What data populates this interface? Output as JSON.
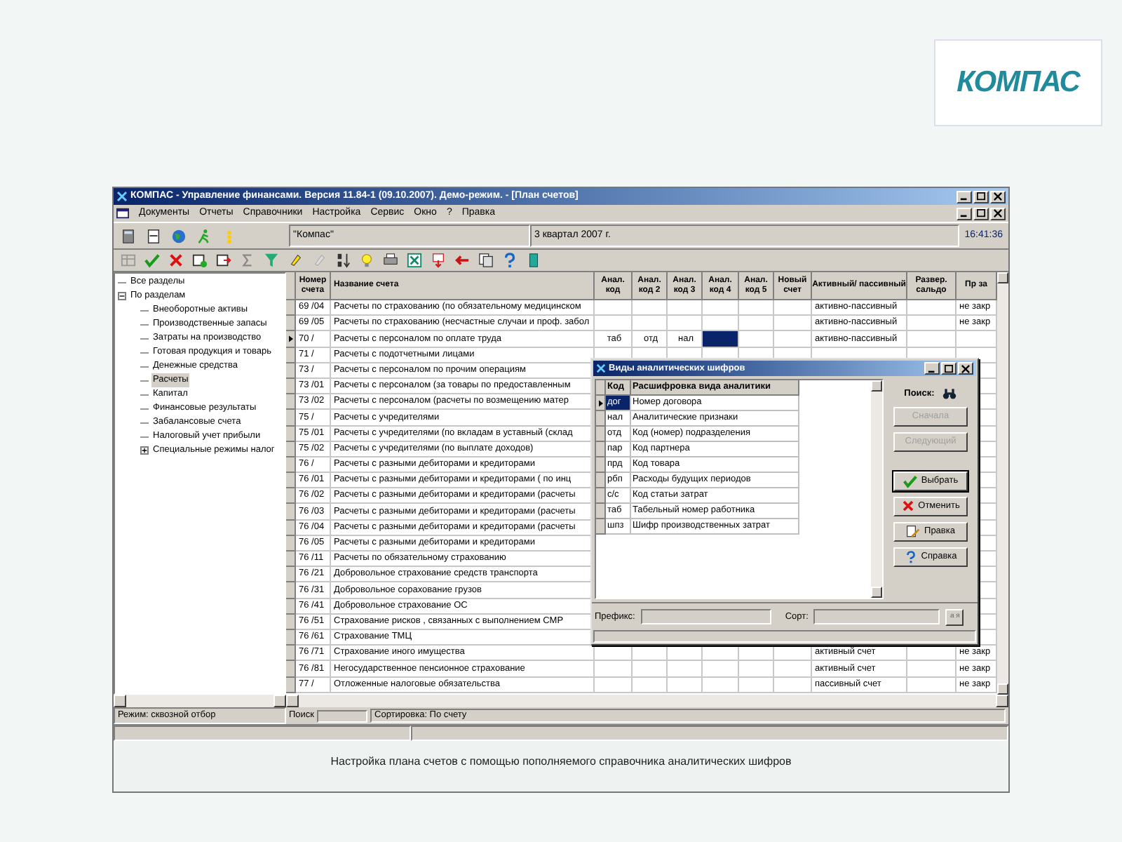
{
  "logo": {
    "text": "КОМПАС"
  },
  "window": {
    "title": "КОМПАС - Управление финансами. Версия 11.84-1 (09.10.2007). Демо-режим. - [План счетов]"
  },
  "menu": [
    "Документы",
    "Отчеты",
    "Справочники",
    "Настройка",
    "Сервис",
    "Окно",
    "?",
    "Правка"
  ],
  "toolbar": {
    "company": "\"Компас\"",
    "period": "3 квартал 2007 г.",
    "time": "16:41:36"
  },
  "tree": {
    "items": [
      {
        "label": "Все разделы",
        "selected": false
      },
      {
        "label": "По разделам",
        "selected": false,
        "expanded": true,
        "children": [
          {
            "label": "Внеоборотные активы",
            "selected": false
          },
          {
            "label": "Производственные запасы",
            "selected": false
          },
          {
            "label": "Затраты на производство",
            "selected": false
          },
          {
            "label": "Готовая продукция и товарь",
            "selected": false
          },
          {
            "label": "Денежные средства",
            "selected": false
          },
          {
            "label": "Расчеты",
            "selected": true
          },
          {
            "label": "Капитал",
            "selected": false
          },
          {
            "label": "Финансовые результаты",
            "selected": false
          },
          {
            "label": "Забалансовые счета",
            "selected": false
          },
          {
            "label": "Налоговый учет прибыли",
            "selected": false
          },
          {
            "label": "Специальные режимы налог",
            "selected": false,
            "expanded": false
          }
        ]
      }
    ],
    "mode": "Режим: сквозной отбор"
  },
  "table": {
    "columns": [
      "Номер счета",
      "Название счета",
      "Анал. код",
      "Анал. код 2",
      "Анал. код 3",
      "Анал. код 4",
      "Анал. код 5",
      "Новый счет",
      "Активный/ пассивный",
      "Развер. сальдо",
      "Пр за"
    ],
    "rows": [
      {
        "number": "69 /04",
        "name": "Расчеты по страхованию (по обязательному медицинском",
        "active_passive": "активно-пассивный",
        "closing": "не закр",
        "selected": false
      },
      {
        "number": "69 /05",
        "name": "Расчеты по страхованию (несчастные случаи и проф. забол",
        "active_passive": "активно-пассивный",
        "closing": "не закр",
        "selected": false
      },
      {
        "number": "70 /",
        "name": "Расчеты с персоналом по оплате труда",
        "code_1": "таб",
        "code_2": "отд",
        "code_3": "нал",
        "code_4_selected": true,
        "active_passive": "активно-пассивный",
        "selected": true
      },
      {
        "number": "71 /",
        "name": "Расчеты с подотчетными лицами",
        "selected": false
      },
      {
        "number": "73 /",
        "name": "Расчеты с персоналом по прочим операциям",
        "selected": false
      },
      {
        "number": "73 /01",
        "name": "Расчеты с персоналом (за товары по предоставленным",
        "selected": false
      },
      {
        "number": "73 /02",
        "name": "Расчеты с персоналом (расчеты по возмещению матер",
        "selected": false
      },
      {
        "number": "75 /",
        "name": "Расчеты с учредителями",
        "selected": false
      },
      {
        "number": "75 /01",
        "name": "Расчеты с учредителями (по вкладам в уставный (склад",
        "selected": false
      },
      {
        "number": "75 /02",
        "name": "Расчеты с учредителями (по выплате доходов)",
        "selected": false
      },
      {
        "number": "76 /",
        "name": "Расчеты с разными дебиторами и кредиторами",
        "selected": false
      },
      {
        "number": "76 /01",
        "name": "Расчеты с разными дебиторами и кредиторами ( по инц",
        "selected": false
      },
      {
        "number": "76 /02",
        "name": "Расчеты с разными дебиторами и кредиторами (расчеты",
        "selected": false
      },
      {
        "number": "76 /03",
        "name": "Расчеты с разными дебиторами и кредиторами (расчеты",
        "selected": false
      },
      {
        "number": "76 /04",
        "name": "Расчеты с разными дебиторами и кредиторами (расчеты",
        "selected": false
      },
      {
        "number": "76 /05",
        "name": "Расчеты с разными дебиторами и кредиторами",
        "selected": false
      },
      {
        "number": "76 /11",
        "name": "Расчеты по обязательному страхованию",
        "selected": false
      },
      {
        "number": "76 /21",
        "name": "Добровольное страхование средств транспорта",
        "selected": false
      },
      {
        "number": "76 /31",
        "name": "Добровольное сорахование грузов",
        "selected": false
      },
      {
        "number": "76 /41",
        "name": "Добровольное страхование ОС",
        "selected": false
      },
      {
        "number": "76 /51",
        "name": "Страхование рисков , связанных с выполнением СМР",
        "selected": false
      },
      {
        "number": "76 /61",
        "name": "Страхование ТМЦ",
        "selected": false
      },
      {
        "number": "76 /71",
        "name": "Страхование иного имущества",
        "active_passive": "активный счет",
        "closing": "не закр",
        "selected": false
      },
      {
        "number": "76 /81",
        "name": "Негосударственное пенсионное страхование",
        "active_passive": "активный счет",
        "closing": "не закр",
        "selected": false
      },
      {
        "number": "77 /",
        "name": "Отложенные налоговые обязательства",
        "active_passive": "пассивный счет",
        "closing": "не закр",
        "selected": false
      }
    ],
    "search_label": "Поиск",
    "sort": "Сортировка: По счету"
  },
  "dialog": {
    "title": "Виды аналитических шифров",
    "columns": [
      "Код",
      "Расшифровка вида аналитики"
    ],
    "rows": [
      {
        "code": "дог",
        "text": "Номер договора",
        "selected": true
      },
      {
        "code": "нал",
        "text": "Аналитические признаки",
        "selected": false
      },
      {
        "code": "отд",
        "text": "Код (номер) подразделения",
        "selected": false
      },
      {
        "code": "пар",
        "text": "Код партнера",
        "selected": false
      },
      {
        "code": "прд",
        "text": "Код товара",
        "selected": false
      },
      {
        "code": "рбп",
        "text": "Расходы будущих периодов",
        "selected": false
      },
      {
        "code": "с/с",
        "text": "Код статьи затрат",
        "selected": false
      },
      {
        "code": "таб",
        "text": "Табельный номер работника",
        "selected": false
      },
      {
        "code": "шпз",
        "text": "Шифр производственных затрат",
        "selected": false
      }
    ],
    "search_label": "Поиск:",
    "buttons": [
      {
        "label": "Сначала",
        "kind": "plain",
        "disabled": true
      },
      {
        "label": "Следующий",
        "kind": "plain",
        "disabled": true
      },
      {
        "label": "Выбрать",
        "kind": "select",
        "disabled": false
      },
      {
        "label": "Отменить",
        "kind": "cancel",
        "disabled": false
      },
      {
        "label": "Правка",
        "kind": "edit",
        "disabled": false
      },
      {
        "label": "Справка",
        "kind": "help",
        "disabled": false
      }
    ],
    "prefix_label": "Префикс:",
    "sort_label": "Сорт:",
    "sort_button": "а я"
  },
  "caption": "Настройка плана счетов с помощью пополняемого справочника аналитических шифров"
}
